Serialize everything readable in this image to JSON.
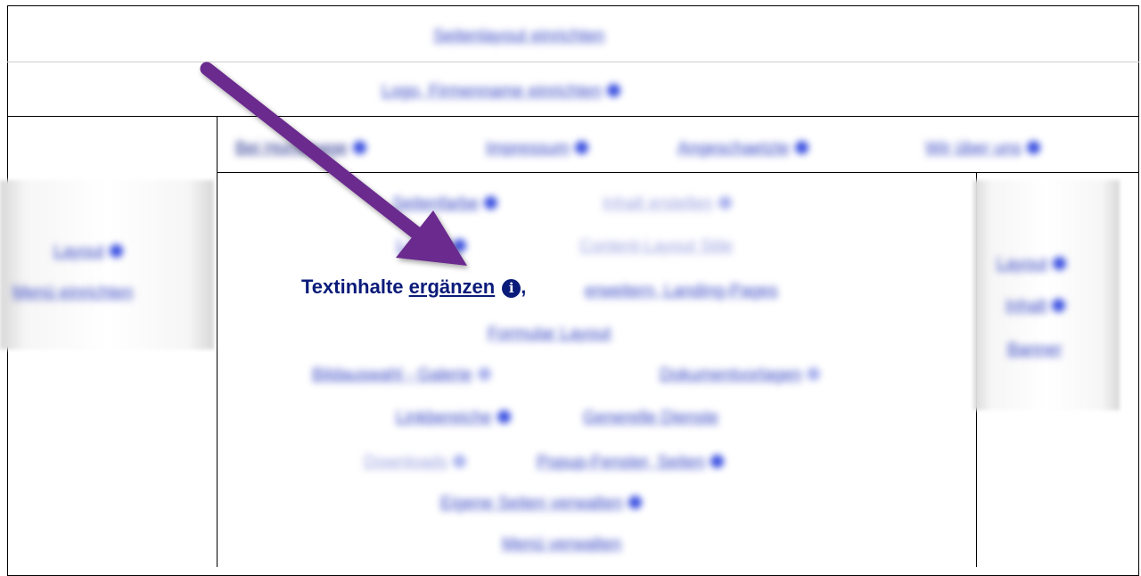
{
  "header": {
    "row1_link": "Seitenlayout einrichten",
    "row2_link": "Logo, Firmenname einrichten"
  },
  "top_nav": [
    "Bei Homepage",
    "Impressum",
    "Angeschaetzte",
    "Wir über uns"
  ],
  "left_sidebar": [
    "Layout",
    "Menü einrichten"
  ],
  "right_sidebar": [
    "Layout",
    "Inhalt",
    "Banner"
  ],
  "center_links": [
    "Seitenfarbe",
    "Inhalt erstellen",
    "Layout",
    "Content-Layout Stile",
    "Formular Layout",
    "Bildauswahl - Galerie",
    "Dokumentvorlagen",
    "Linkbereiche",
    "Generelle Dienste",
    "Downloads",
    "Popup-Fenster, Seiten",
    "Eigene Seiten verwalten",
    "Menü verwalten"
  ],
  "focus": {
    "prefix": "Textinhalte",
    "link": "ergänzen",
    "info_glyph": "i",
    "suffix": ",",
    "blurred_tail": "erweitern, Landing-Pages"
  },
  "colors": {
    "link": "#3646c4",
    "focus_text": "#0b1b7a",
    "arrow": "#6a2a8e"
  }
}
